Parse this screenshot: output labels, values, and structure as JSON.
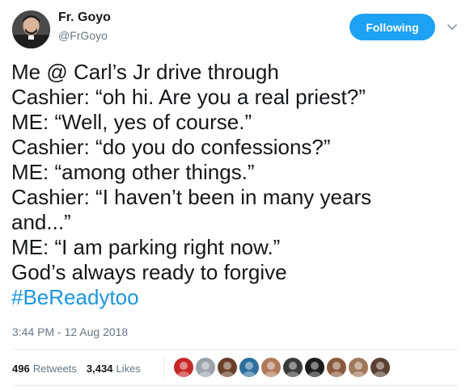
{
  "author": {
    "name": "Fr. Goyo",
    "handle": "@FrGoyo",
    "avatar_icon": "priest-portrait-icon"
  },
  "follow_button": {
    "label": "Following",
    "color": "#1da1f2"
  },
  "caret_icon": "chevron-down-icon",
  "tweet": {
    "lines": [
      "Me @ Carl’s Jr drive through",
      "Cashier: “oh hi. Are you a real priest?”",
      "ME: “Well, yes of course.”",
      "Cashier: “do you do confessions?”",
      "ME: “among other things.”",
      "Cashier: “I haven’t been in many years",
      "and...”",
      "ME: “I am parking right now.”",
      "God’s always ready to forgive"
    ],
    "hashtag": "#BeReadytoo",
    "hashtag_color": "#1b95e0"
  },
  "timestamp": "3:44 PM - 12 Aug 2018",
  "stats": {
    "retweets_count": "496",
    "retweets_label": "Retweets",
    "likes_count": "3,434",
    "likes_label": "Likes"
  },
  "likers": [
    {
      "name": "liker-avatar-1",
      "color": "#c62828"
    },
    {
      "name": "liker-avatar-2",
      "color": "#9aa3ab"
    },
    {
      "name": "liker-avatar-3",
      "color": "#6b3f2a"
    },
    {
      "name": "liker-avatar-4",
      "color": "#2e6f9e"
    },
    {
      "name": "liker-avatar-5",
      "color": "#b07a5a"
    },
    {
      "name": "liker-avatar-6",
      "color": "#3a3a3a"
    },
    {
      "name": "liker-avatar-7",
      "color": "#1c1c1c"
    },
    {
      "name": "liker-avatar-8",
      "color": "#8a5a3c"
    },
    {
      "name": "liker-avatar-9",
      "color": "#a0785a"
    },
    {
      "name": "liker-avatar-10",
      "color": "#5a4030"
    }
  ]
}
